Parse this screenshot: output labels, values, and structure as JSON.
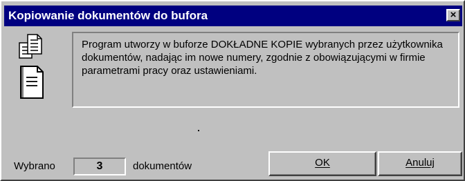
{
  "window": {
    "title": "Kopiowanie dokumentów do bufora",
    "close_glyph": "✕"
  },
  "icons": {
    "main": "documents-copy-icon"
  },
  "message": {
    "text": "Program utworzy w buforze DOKŁADNE KOPIE wybranych przez użytkownika dokumentów, nadając im nowe numery, zgodnie z obowiązującymi w firmie parametrami pracy oraz ustawieniami."
  },
  "selection": {
    "label_prefix": "Wybrano",
    "count": "3",
    "label_suffix": "dokumentów"
  },
  "buttons": {
    "ok_label": "OK",
    "cancel_label": "Anuluj"
  }
}
